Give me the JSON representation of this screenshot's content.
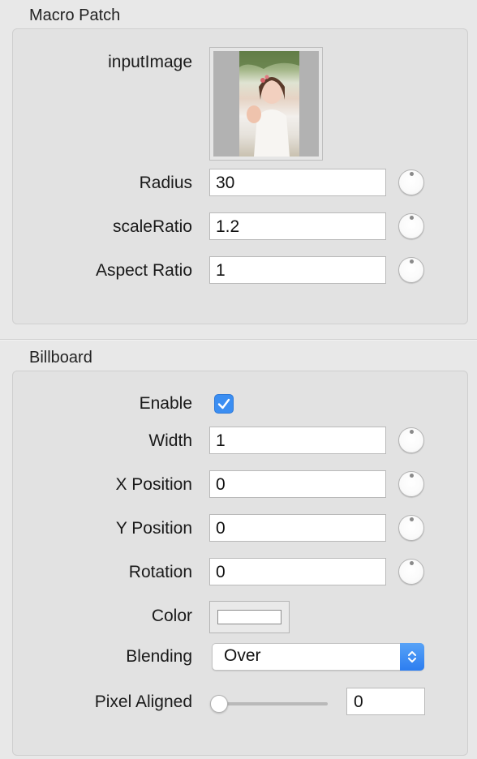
{
  "macro_patch": {
    "title": "Macro Patch",
    "input_image_label": "inputImage",
    "params": [
      {
        "label": "Radius",
        "value": "30"
      },
      {
        "label": "scaleRatio",
        "value": "1.2"
      },
      {
        "label": "Aspect Ratio",
        "value": "1"
      }
    ]
  },
  "billboard": {
    "title": "Billboard",
    "enable_label": "Enable",
    "enable_checked": true,
    "params": [
      {
        "label": "Width",
        "value": "1"
      },
      {
        "label": "X Position",
        "value": "0"
      },
      {
        "label": "Y Position",
        "value": "0"
      },
      {
        "label": "Rotation",
        "value": "0"
      }
    ],
    "color_label": "Color",
    "color_value": "#ffffff",
    "blending_label": "Blending",
    "blending_value": "Over",
    "pixel_aligned_label": "Pixel Aligned",
    "pixel_aligned_value": "0",
    "pixel_aligned_slider_fraction": 0
  },
  "icons": {
    "checkmark": "checkmark-icon",
    "popup_arrows": "up-down-chevron-icon",
    "knob": "dial-knob-icon"
  },
  "colors": {
    "accent": "#3b8ef2",
    "panel": "#e2e2e2"
  }
}
